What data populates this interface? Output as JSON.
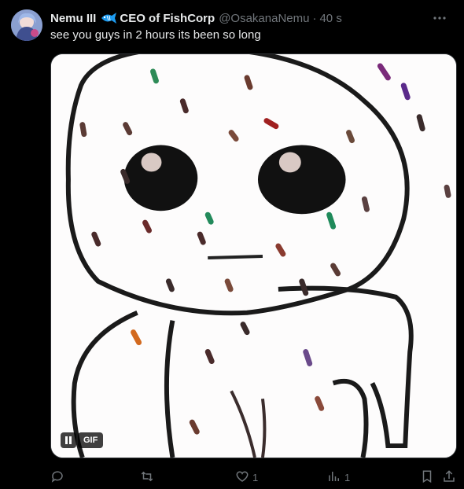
{
  "tweet": {
    "display_name": "Nemu III",
    "name_emoji_icon": "fish-icon",
    "corp_label": "CEO of FishCorp",
    "handle": "@OsakanaNemu",
    "separator": "·",
    "timestamp": "40 s",
    "text": "see you guys in 2 hours its been so long"
  },
  "media": {
    "type": "gif",
    "badge": "GIF",
    "control_icon": "pause-icon"
  },
  "actions": {
    "reply": {
      "icon": "reply-icon",
      "count": ""
    },
    "retweet": {
      "icon": "retweet-icon",
      "count": ""
    },
    "like": {
      "icon": "heart-icon",
      "count": "1"
    },
    "views": {
      "icon": "views-icon",
      "count": "1"
    },
    "bookmark": {
      "icon": "bookmark-icon"
    },
    "share": {
      "icon": "share-icon"
    }
  },
  "colors": {
    "background": "#000000",
    "text_primary": "#e7e9ea",
    "text_secondary": "#71767b",
    "fish_blue": "#1d9bf0"
  }
}
